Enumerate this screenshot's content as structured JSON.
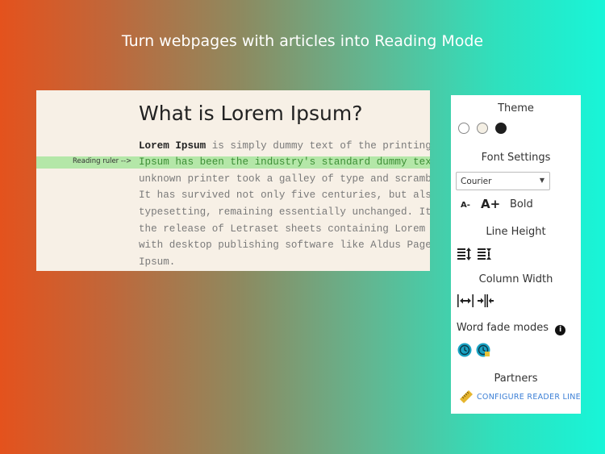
{
  "headline": "Turn webpages with articles into Reading Mode",
  "article": {
    "title": "What is Lorem Ipsum?",
    "ruler_label": "Reading ruler -->",
    "first_line_bold": "Lorem Ipsum",
    "first_line_rest": " is simply dummy text of the printing a",
    "lines": [
      "Ipsum has been the industry's standard dummy text",
      "unknown printer took a galley of type and scramble",
      "It has survived not only five centuries, but also",
      "typesetting, remaining essentially unchanged. It w",
      "the release of Letraset sheets containing Lorem Ip",
      "with desktop publishing software like Aldus PageMa",
      "Ipsum."
    ]
  },
  "panel": {
    "theme_heading": "Theme",
    "font_heading": "Font Settings",
    "font_select_value": "Courier",
    "font_decrease": "A-",
    "font_increase": "A+",
    "bold_label": "Bold",
    "line_height_heading": "Line Height",
    "column_width_heading": "Column Width",
    "word_fade_heading": "Word fade modes",
    "partners_heading": "Partners",
    "configure_link": "CONFIGURE READER LINE"
  },
  "colors": {
    "ruler": "#b4e7a8",
    "link": "#3b7fd6",
    "fade_icon": "#1aa3c4"
  }
}
